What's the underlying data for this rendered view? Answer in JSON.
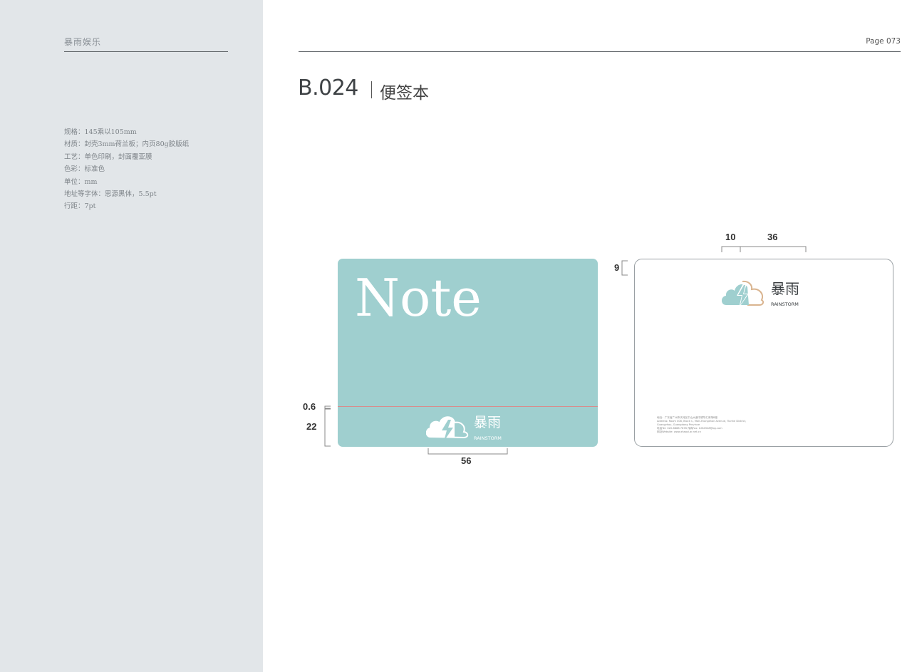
{
  "sidebar": {
    "brand": "暴雨娱乐",
    "specs": [
      "规格：145乘以105mm",
      "材质：封壳3mm荷兰板；内页80g胶版纸",
      "工艺：单色印刷，封面覆亚膜",
      "色彩：标准色",
      "单位：mm",
      "地址等字体：思源黑体，5.5pt",
      "行距：7pt"
    ]
  },
  "header": {
    "page_number": "Page 073",
    "code": "B.024",
    "title": "便签本"
  },
  "cover": {
    "note_word": "Note",
    "logo_cn": "暴雨",
    "logo_en": "RAINSTORM"
  },
  "back": {
    "logo_cn": "暴雨",
    "logo_en": "RAINSTORM",
    "address_lines": [
      "地址：广东省广州市天河区中山大道中锦华汇商场B座",
      "Address: Room 408, Block C, Mall Zhongshan Avenue, Tianhe District,",
      "Guangzhou, Guangdong Province",
      "电话Tel: 020-8888 7878    传真Fax: 1284548@qq.com",
      "网址Website: www.zhaozi.ar.net.cn"
    ]
  },
  "dimensions": {
    "cover_line": "0.6",
    "cover_band": "22",
    "cover_logo_width": "56",
    "back_top_margin": "9",
    "back_logo_offset": "10",
    "back_logo_width": "36"
  },
  "colors": {
    "sidebar_bg": "#e2e6e9",
    "brand_teal": "#9fcfcf",
    "logo_tan": "#d9b48f",
    "cover_line": "#d98c8c"
  }
}
